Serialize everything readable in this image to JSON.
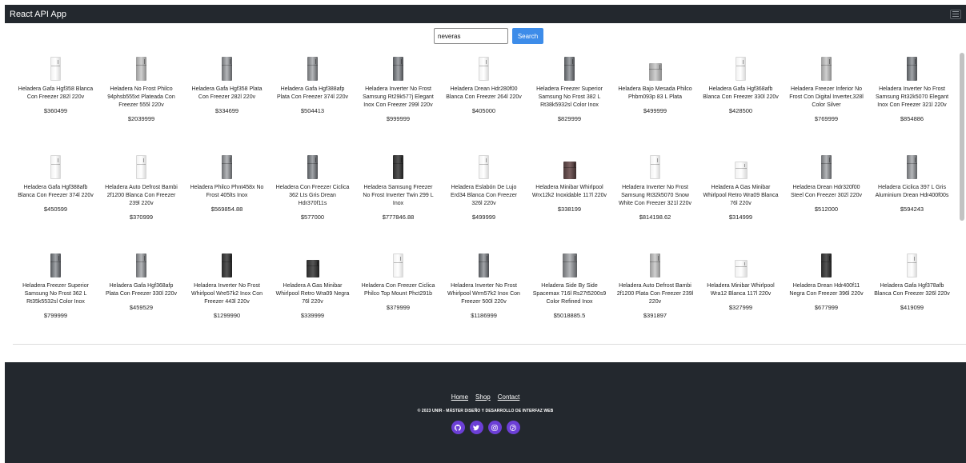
{
  "app": {
    "title": "React API App"
  },
  "search": {
    "value": "neveras",
    "button_label": "Search"
  },
  "products": [
    {
      "name": "Heladera Gafa Hgf358 Blanca Con Freezer 282l 220v",
      "price": "$360499",
      "finish": "white"
    },
    {
      "name": "Heladera No Frost Philco 94phsb555xt Plateada Con Freezer 555l 220v",
      "price": "$2039999",
      "finish": "silver"
    },
    {
      "name": "Heladera Gafa Hgf358 Plata Con Freezer 282l 220v",
      "price": "$334699",
      "finish": "steel"
    },
    {
      "name": "Heladera Gafa Hgf388afp Plata Con Freezer 374l 220v",
      "price": "$504413",
      "finish": "steel"
    },
    {
      "name": "Heladera Inverter No Frost Samsung Rt29k577j Elegant Inox Con Freezer 299l 220v",
      "price": "$999999",
      "finish": "inox"
    },
    {
      "name": "Heladera Drean Hdr280f00 Blanca Con Freezer 264l 220v",
      "price": "$405000",
      "finish": "white"
    },
    {
      "name": "Heladera Freezer Superior Samsung No Frost 382 L Rt38k5932sl Color Inox",
      "price": "$829999",
      "finish": "inox"
    },
    {
      "name": "Heladera Bajo Mesada Philco Phbm093p 83 L Plata",
      "price": "$499999",
      "finish": "silver"
    },
    {
      "name": "Heladera Gafa Hgf368afb Blanca Con Freezer 330l 220v",
      "price": "$428500",
      "finish": "white"
    },
    {
      "name": "Heladera Freezer Inferior No Frost Con Digital Inverter,328l Color Silver",
      "price": "$769999",
      "finish": "silver"
    },
    {
      "name": "Heladera Inverter No Frost Samsung Rt32k5070 Elegant Inox Con Freezer 321l 220v",
      "price": "$854886",
      "finish": "inox"
    },
    {
      "name": "Heladera Gafa Hgf388afb Blanca Con Freezer 374l 220v",
      "price": "$450599",
      "finish": "white"
    },
    {
      "name": "Heladera Auto Defrost Bambi 2f1200 Blanca Con Freezer 239l 220v",
      "price": "$370999",
      "finish": "white"
    },
    {
      "name": "Heladera Philco Phnt458x No Frost 405lts Inox",
      "price": "$569854.88",
      "finish": "steel"
    },
    {
      "name": "Heladera Con Freezer Ciclica 362 Lts Gris Drean Hdr370f11s",
      "price": "$577000",
      "finish": "inox"
    },
    {
      "name": "Heladera Samsung Freezer No Frost Inverter Twin 299 L Inox",
      "price": "$777846.88",
      "finish": "dark"
    },
    {
      "name": "Heladera Eslabón De Lujo Erd34 Blanca Con Freezer 326l 220v",
      "price": "$499999",
      "finish": "white"
    },
    {
      "name": "Heladera Minibar Whirlpool Wrx12k2 Inoxidable 117l 220v",
      "price": "$338199",
      "finish": "brown"
    },
    {
      "name": "Heladera Inverter No Frost Samsung Rt32k5070 Snow White Con Freezer 321l 220v",
      "price": "$814198.62",
      "finish": "white"
    },
    {
      "name": "Heladera A Gas Minibar Whirlpool Retro Wra09 Blanca 76l 220v",
      "price": "$314999",
      "finish": "white"
    },
    {
      "name": "Heladera Drean Hdr320f00 Steel Con Freezer 302l 220v",
      "price": "$512000",
      "finish": "steel"
    },
    {
      "name": "Heladera Ciclica 397 L Gris Aluminium Drean Hdr400f00s",
      "price": "$594243",
      "finish": "steel"
    },
    {
      "name": "Heladera Freezer Superior Samsung No Frost 362 L Rt35k5532sl Color Inox",
      "price": "$799999",
      "finish": "inox"
    },
    {
      "name": "Heladera Gafa Hgf368afp Plata Con Freezer 330l 220v",
      "price": "$459529",
      "finish": "steel"
    },
    {
      "name": "Heladera Inverter No Frost Whirlpool Wre57k2 Inox Con Freezer 443l 220v",
      "price": "$1299990",
      "finish": "dark"
    },
    {
      "name": "Heladera A Gas Minibar Whirlpool Retro Wra09 Negra 76l 220v",
      "price": "$339999",
      "finish": "dark"
    },
    {
      "name": "Heladera Con Freezer Ciclica Philco Top Mount Phct291b",
      "price": "$379999",
      "finish": "white"
    },
    {
      "name": "Heladera Inverter No Frost Whirlpool Wrm57k2 Inox Con Freezer 500l 220v",
      "price": "$1186999",
      "finish": "inox"
    },
    {
      "name": "Heladera Side By Side Spacemax 716l Rs27t5200s9 Color Refined Inox",
      "price": "$5018885.5",
      "finish": "steel"
    },
    {
      "name": "Heladera Auto Defrost Bambi 2f1200 Plata Con Freezer 239l 220v",
      "price": "$391897",
      "finish": "silver"
    },
    {
      "name": "Heladera Minibar Whirlpool Wra12 Blanca 117l 220v",
      "price": "$327999",
      "finish": "white"
    },
    {
      "name": "Heladera Drean Hdr400f11 Negra Con Freezer 396l 220v",
      "price": "$677999",
      "finish": "dark"
    },
    {
      "name": "Heladera Gafa Hgf378afb Blanca Con Freezer 326l 220v",
      "price": "$419099",
      "finish": "white"
    }
  ],
  "footer": {
    "links": [
      "Home",
      "Shop",
      "Contact"
    ],
    "copyright": "© 2023 UNIR - MÁSTER DISEÑO Y DESARROLLO DE INTERFAZ WEB",
    "social": [
      {
        "icon": "github-icon"
      },
      {
        "icon": "twitter-icon"
      },
      {
        "icon": "instagram-icon"
      },
      {
        "icon": "pinterest-icon"
      }
    ]
  },
  "colors": {
    "navbar": "#23282e",
    "search_button": "#3d8ce9",
    "social": "#6c3fd6"
  }
}
